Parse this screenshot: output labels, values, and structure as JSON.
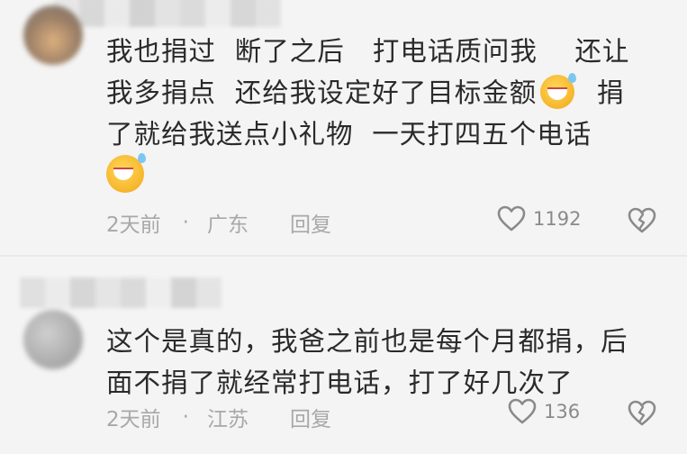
{
  "comments": [
    {
      "text_line1": "我也捐过  断了之后   打电话质问我    还让",
      "text_line2a": "我多捐点  还给我设定好了目标金额",
      "text_line2b": "  捐",
      "text_line3": "了就给我送点小礼物  一天打四五个电话",
      "time": "2天前",
      "separator": "·",
      "location": "广东",
      "reply_label": "回复",
      "like_count": "1192",
      "emoji_icon": "grinning-sweat-emoji-icon"
    },
    {
      "text": "这个是真的，我爸之前也是每个月都捐，后\n面不捐了就经常打电话，打了好几次了",
      "time": "2天前",
      "separator": "·",
      "location": "江苏",
      "reply_label": "回复",
      "like_count": "136"
    }
  ],
  "colors": {
    "background": "#f4f4f4",
    "text": "#2a2a2a",
    "meta": "#a8a8a8",
    "icon": "#8a8a8a"
  }
}
